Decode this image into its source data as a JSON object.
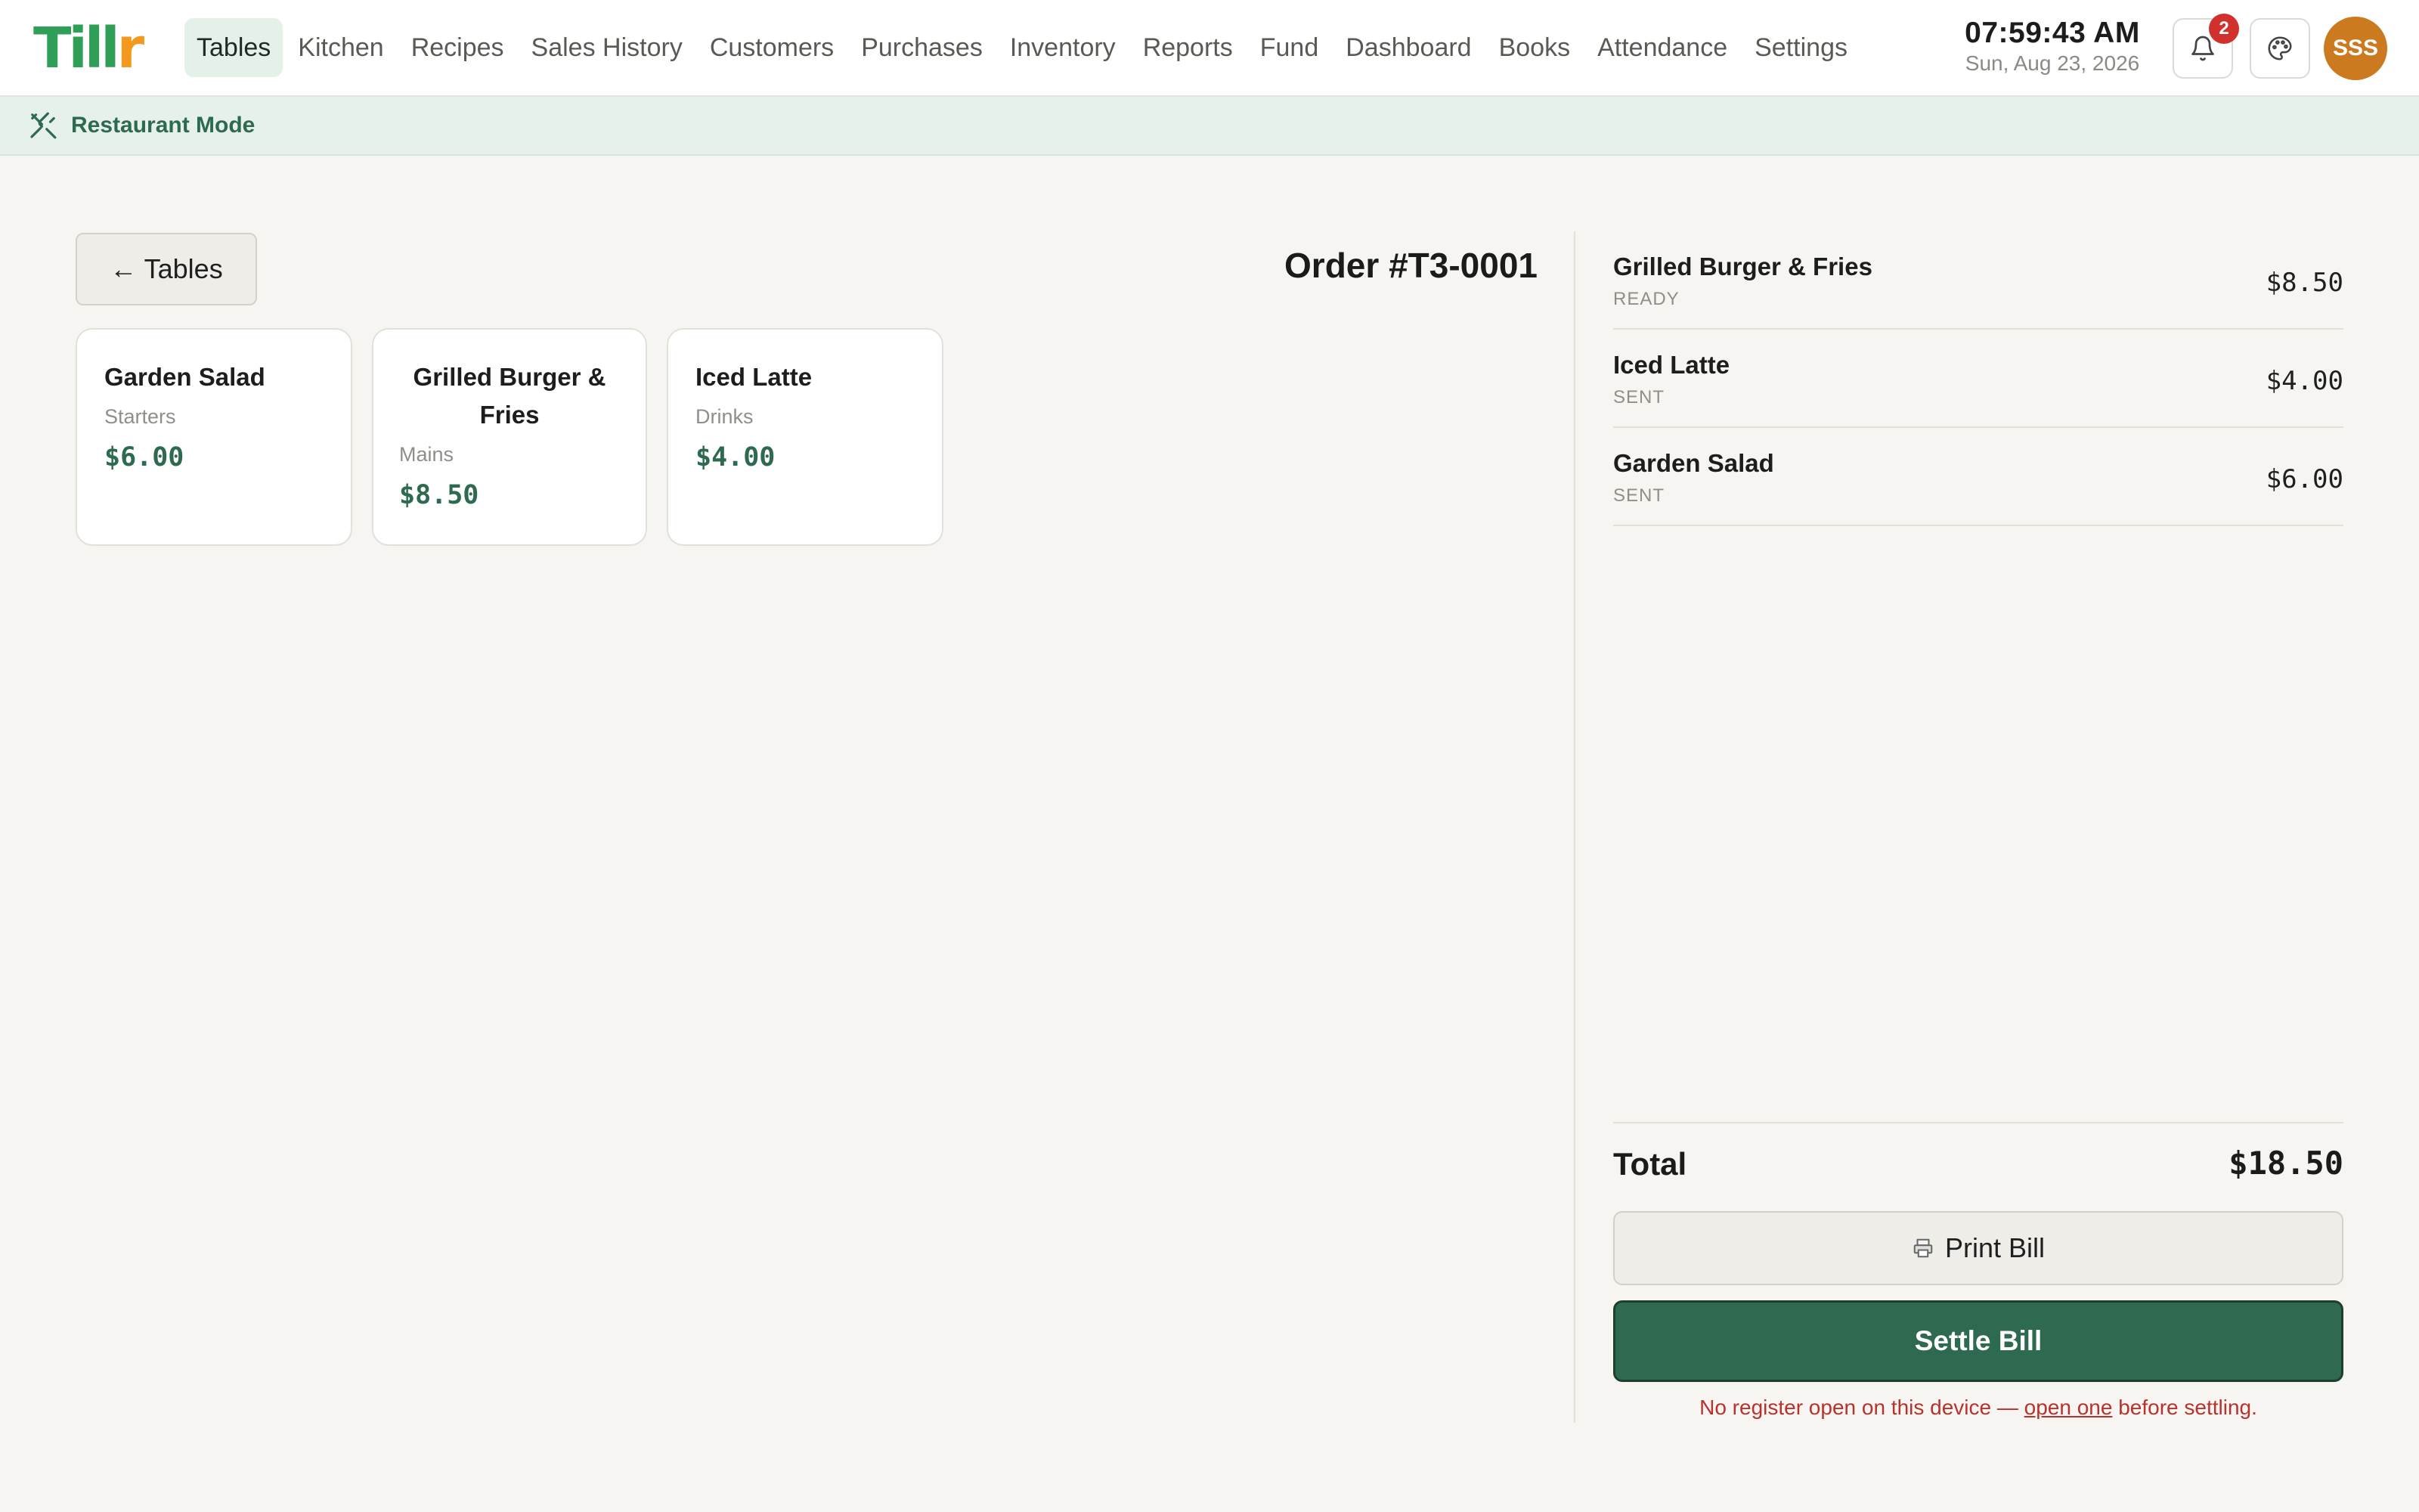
{
  "app": {
    "logo_main": "Till",
    "logo_accent": "r"
  },
  "nav": {
    "items": [
      {
        "label": "Tables",
        "active": true
      },
      {
        "label": "Kitchen"
      },
      {
        "label": "Recipes"
      },
      {
        "label": "Sales History"
      },
      {
        "label": "Customers"
      },
      {
        "label": "Purchases"
      },
      {
        "label": "Inventory"
      },
      {
        "label": "Reports"
      },
      {
        "label": "Fund"
      },
      {
        "label": "Dashboard"
      },
      {
        "label": "Books"
      },
      {
        "label": "Attendance"
      },
      {
        "label": "Settings"
      }
    ]
  },
  "clock": {
    "time": "07:59:43 AM",
    "date": "Sun, Aug 23, 2026"
  },
  "notifications": {
    "icon": "bell-icon",
    "count": "2"
  },
  "theme": {
    "icon": "palette-icon"
  },
  "user": {
    "initials": "SSS"
  },
  "mode": {
    "icon": "utensils-crossed-icon",
    "label": "Restaurant Mode"
  },
  "back": {
    "label": "← Tables"
  },
  "order": {
    "title": "Order #T3-0001"
  },
  "menu": [
    {
      "name": "Garden Salad",
      "category": "Starters",
      "price": "$6.00"
    },
    {
      "name": "Grilled Burger & Fries",
      "category": "Mains",
      "price": "$8.50"
    },
    {
      "name": "Iced Latte",
      "category": "Drinks",
      "price": "$4.00"
    }
  ],
  "order_lines": [
    {
      "name": "Grilled Burger & Fries",
      "status": "READY",
      "price": "$8.50"
    },
    {
      "name": "Iced Latte",
      "status": "SENT",
      "price": "$4.00"
    },
    {
      "name": "Garden Salad",
      "status": "SENT",
      "price": "$6.00"
    }
  ],
  "totals": {
    "label": "Total",
    "value": "$18.50"
  },
  "actions": {
    "print_label": "Print Bill",
    "print_icon": "printer-icon",
    "settle_label": "Settle Bill"
  },
  "warning": {
    "prefix": "No register open on this device — ",
    "link": "open one",
    "suffix": " before settling."
  },
  "colors": {
    "brand_green": "#2d6a4f",
    "logo_green": "#2f9e56",
    "logo_orange": "#f39a1e",
    "warning_red": "#b8322d",
    "badge_red": "#d0312d",
    "avatar_orange": "#cc7a1f"
  }
}
